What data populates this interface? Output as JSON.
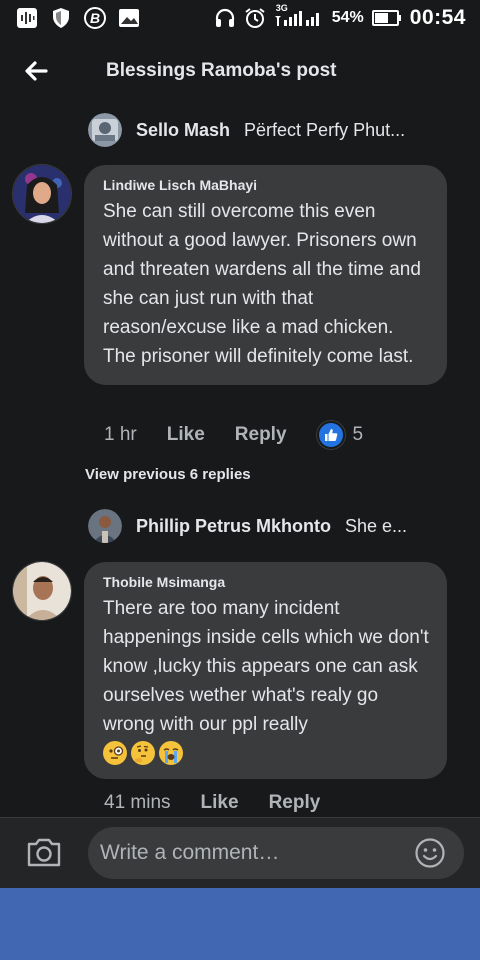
{
  "status_bar": {
    "network": "3G",
    "battery": "54%",
    "time": "00:54"
  },
  "header": {
    "title": "Blessings Ramoba's post"
  },
  "replies": [
    {
      "name": "Sello Mash",
      "snippet": "Pёrfect Perfy Phut..."
    },
    {
      "name": "Phillip Petrus Mkhonto",
      "snippet": "She e..."
    }
  ],
  "comments": [
    {
      "author": "Lindiwe Lisch MaBhayi",
      "text": "She can still overcome this even without a good lawyer. Prisoners own and threaten wardens all the time and she can just run with that reason/excuse like a mad chicken. The prisoner will definitely come last.",
      "time": "1 hr",
      "like_label": "Like",
      "reply_label": "Reply",
      "reaction_count": "5"
    },
    {
      "author": "Thobile Msimanga",
      "text": "There are too many incident happenings inside cells which we don't know ,lucky this appears one can ask ourselves wether what's realy go wrong with our ppl really",
      "emojis": [
        "face-with-monocle-icon",
        "thinking-face-icon",
        "loudly-crying-face-icon"
      ],
      "time": "41 mins",
      "like_label": "Like",
      "reply_label": "Reply"
    }
  ],
  "view_previous": "View previous 6 replies",
  "composer": {
    "placeholder": "Write a comment…"
  },
  "colors": {
    "background": "#18191a",
    "bubble": "#3a3b3c",
    "like_blue": "#2374e1",
    "nav_blue": "#4267b2"
  }
}
